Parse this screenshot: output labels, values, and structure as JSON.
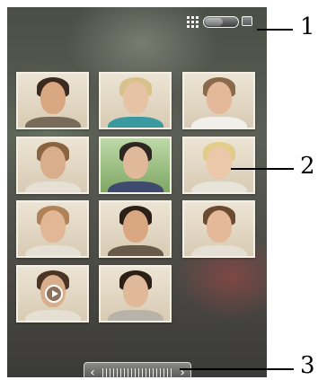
{
  "toolbar": {
    "grid_view_icon": "grid-icon",
    "toggle_icon": "toggle-switch-icon",
    "single_view_icon": "single-photo-icon"
  },
  "thumbnails": [
    {
      "name": "photo-man-mohawk",
      "skin": "#d9a882",
      "hair": "#3b2a1f",
      "clothes": "#7a6a5a",
      "bg": "default"
    },
    {
      "name": "photo-woman-blonde-curly",
      "skin": "#e7c3a6",
      "hair": "#d8c28c",
      "clothes": "#3a9aa0",
      "bg": "default"
    },
    {
      "name": "photo-woman-smiling",
      "skin": "#e3b99a",
      "hair": "#8a6a4a",
      "clothes": "#f0efe9",
      "bg": "default"
    },
    {
      "name": "photo-woman-ponytail",
      "skin": "#d9ae8d",
      "hair": "#8a6440",
      "clothes": "#e6e0d4",
      "bg": "default"
    },
    {
      "name": "photo-woman-outdoors",
      "skin": "#e0b89a",
      "hair": "#2e2620",
      "clothes": "#3e4a6e",
      "bg": "green"
    },
    {
      "name": "photo-woman-blonde-laughing",
      "skin": "#ebc8aa",
      "hair": "#e2cc8a",
      "clothes": "#e8e4da",
      "bg": "default"
    },
    {
      "name": "photo-woman-smiling-wide",
      "skin": "#e2b795",
      "hair": "#b0825a",
      "clothes": "#e6e0d4",
      "bg": "default"
    },
    {
      "name": "photo-man-dark-hair",
      "skin": "#d9a882",
      "hair": "#2a2018",
      "clothes": "#6a5a4a",
      "bg": "default"
    },
    {
      "name": "photo-woman-side-smile",
      "skin": "#e3b99a",
      "hair": "#6a4a30",
      "clothes": "#e6e0d4",
      "bg": "default"
    },
    {
      "name": "video-woman",
      "skin": "#d9ae8d",
      "hair": "#4a3426",
      "clothes": "#e6e0d4",
      "bg": "default",
      "video": true
    },
    {
      "name": "photo-man-glasses",
      "skin": "#e0b89a",
      "hair": "#2a2018",
      "clothes": "#b9b2a8",
      "bg": "default"
    }
  ],
  "scrollbar": {
    "left_arrow": "‹",
    "right_arrow": "›"
  },
  "callouts": [
    {
      "label": "1"
    },
    {
      "label": "2"
    },
    {
      "label": "3"
    }
  ]
}
